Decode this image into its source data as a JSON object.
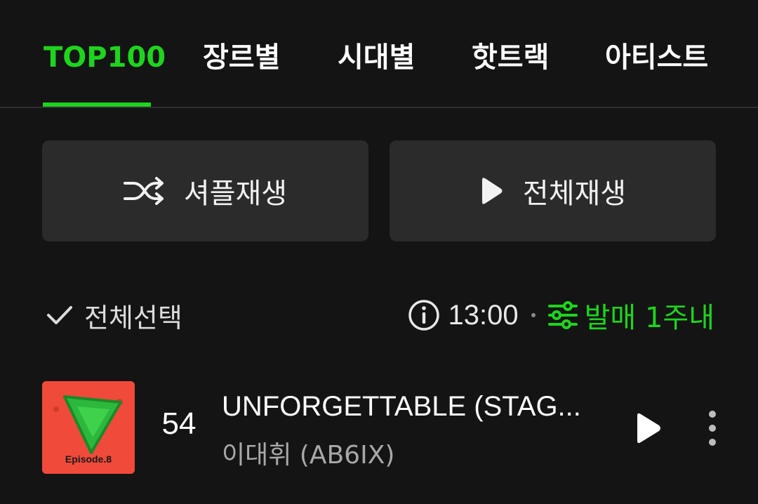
{
  "tabs": [
    {
      "label": "TOP100",
      "active": true
    },
    {
      "label": "장르별",
      "active": false
    },
    {
      "label": "시대별",
      "active": false
    },
    {
      "label": "핫트랙",
      "active": false
    },
    {
      "label": "아티스트",
      "active": false
    }
  ],
  "actions": {
    "shuffle_label": "셔플재생",
    "play_all_label": "전체재생"
  },
  "filter_row": {
    "select_all_label": "전체선택",
    "time": "13:00",
    "filter_label": "발매 1주내"
  },
  "tracks": [
    {
      "rank": "54",
      "title": "UNFORGETTABLE (STAG...",
      "artist": "이대휘 (AB6IX)",
      "album_art_text": "Episode.8"
    }
  ],
  "colors": {
    "background": "#141414",
    "accent": "#1ed41e",
    "button_bg": "#2b2b2b"
  }
}
